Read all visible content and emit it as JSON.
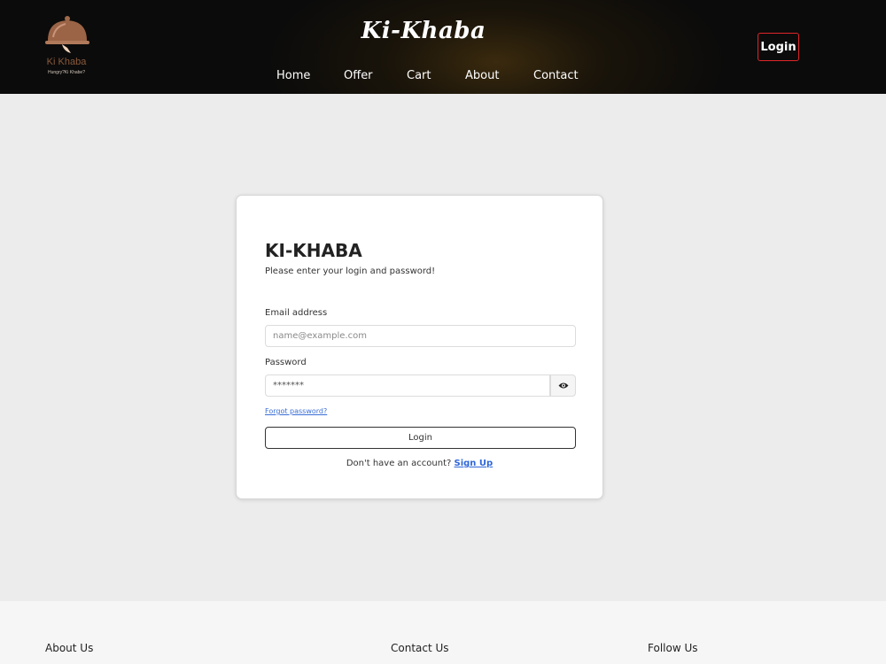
{
  "header": {
    "logo_name": "Ki Khaba",
    "logo_tagline": "Hungry?Ki Khabe?",
    "brand": "Ki-Khaba",
    "nav": [
      "Home",
      "Offer",
      "Cart",
      "About",
      "Contact"
    ],
    "login_label": "Login"
  },
  "login_card": {
    "title": "KI-KHABA",
    "subtitle": "Please enter your login and password!",
    "email_label": "Email address",
    "email_placeholder": "name@example.com",
    "password_label": "Password",
    "password_value": "*******",
    "forgot_label": "Forgot password?",
    "submit_label": "Login",
    "signup_prompt": "Don't have an account?",
    "signup_link": "Sign Up"
  },
  "footer": {
    "headings": [
      "About Us",
      "Contact Us",
      "Follow Us"
    ]
  },
  "colors": {
    "header_bg": "#0b0b0b",
    "login_border": "#e0252a",
    "link": "#2f67d8",
    "page_bg": "#ececec"
  }
}
